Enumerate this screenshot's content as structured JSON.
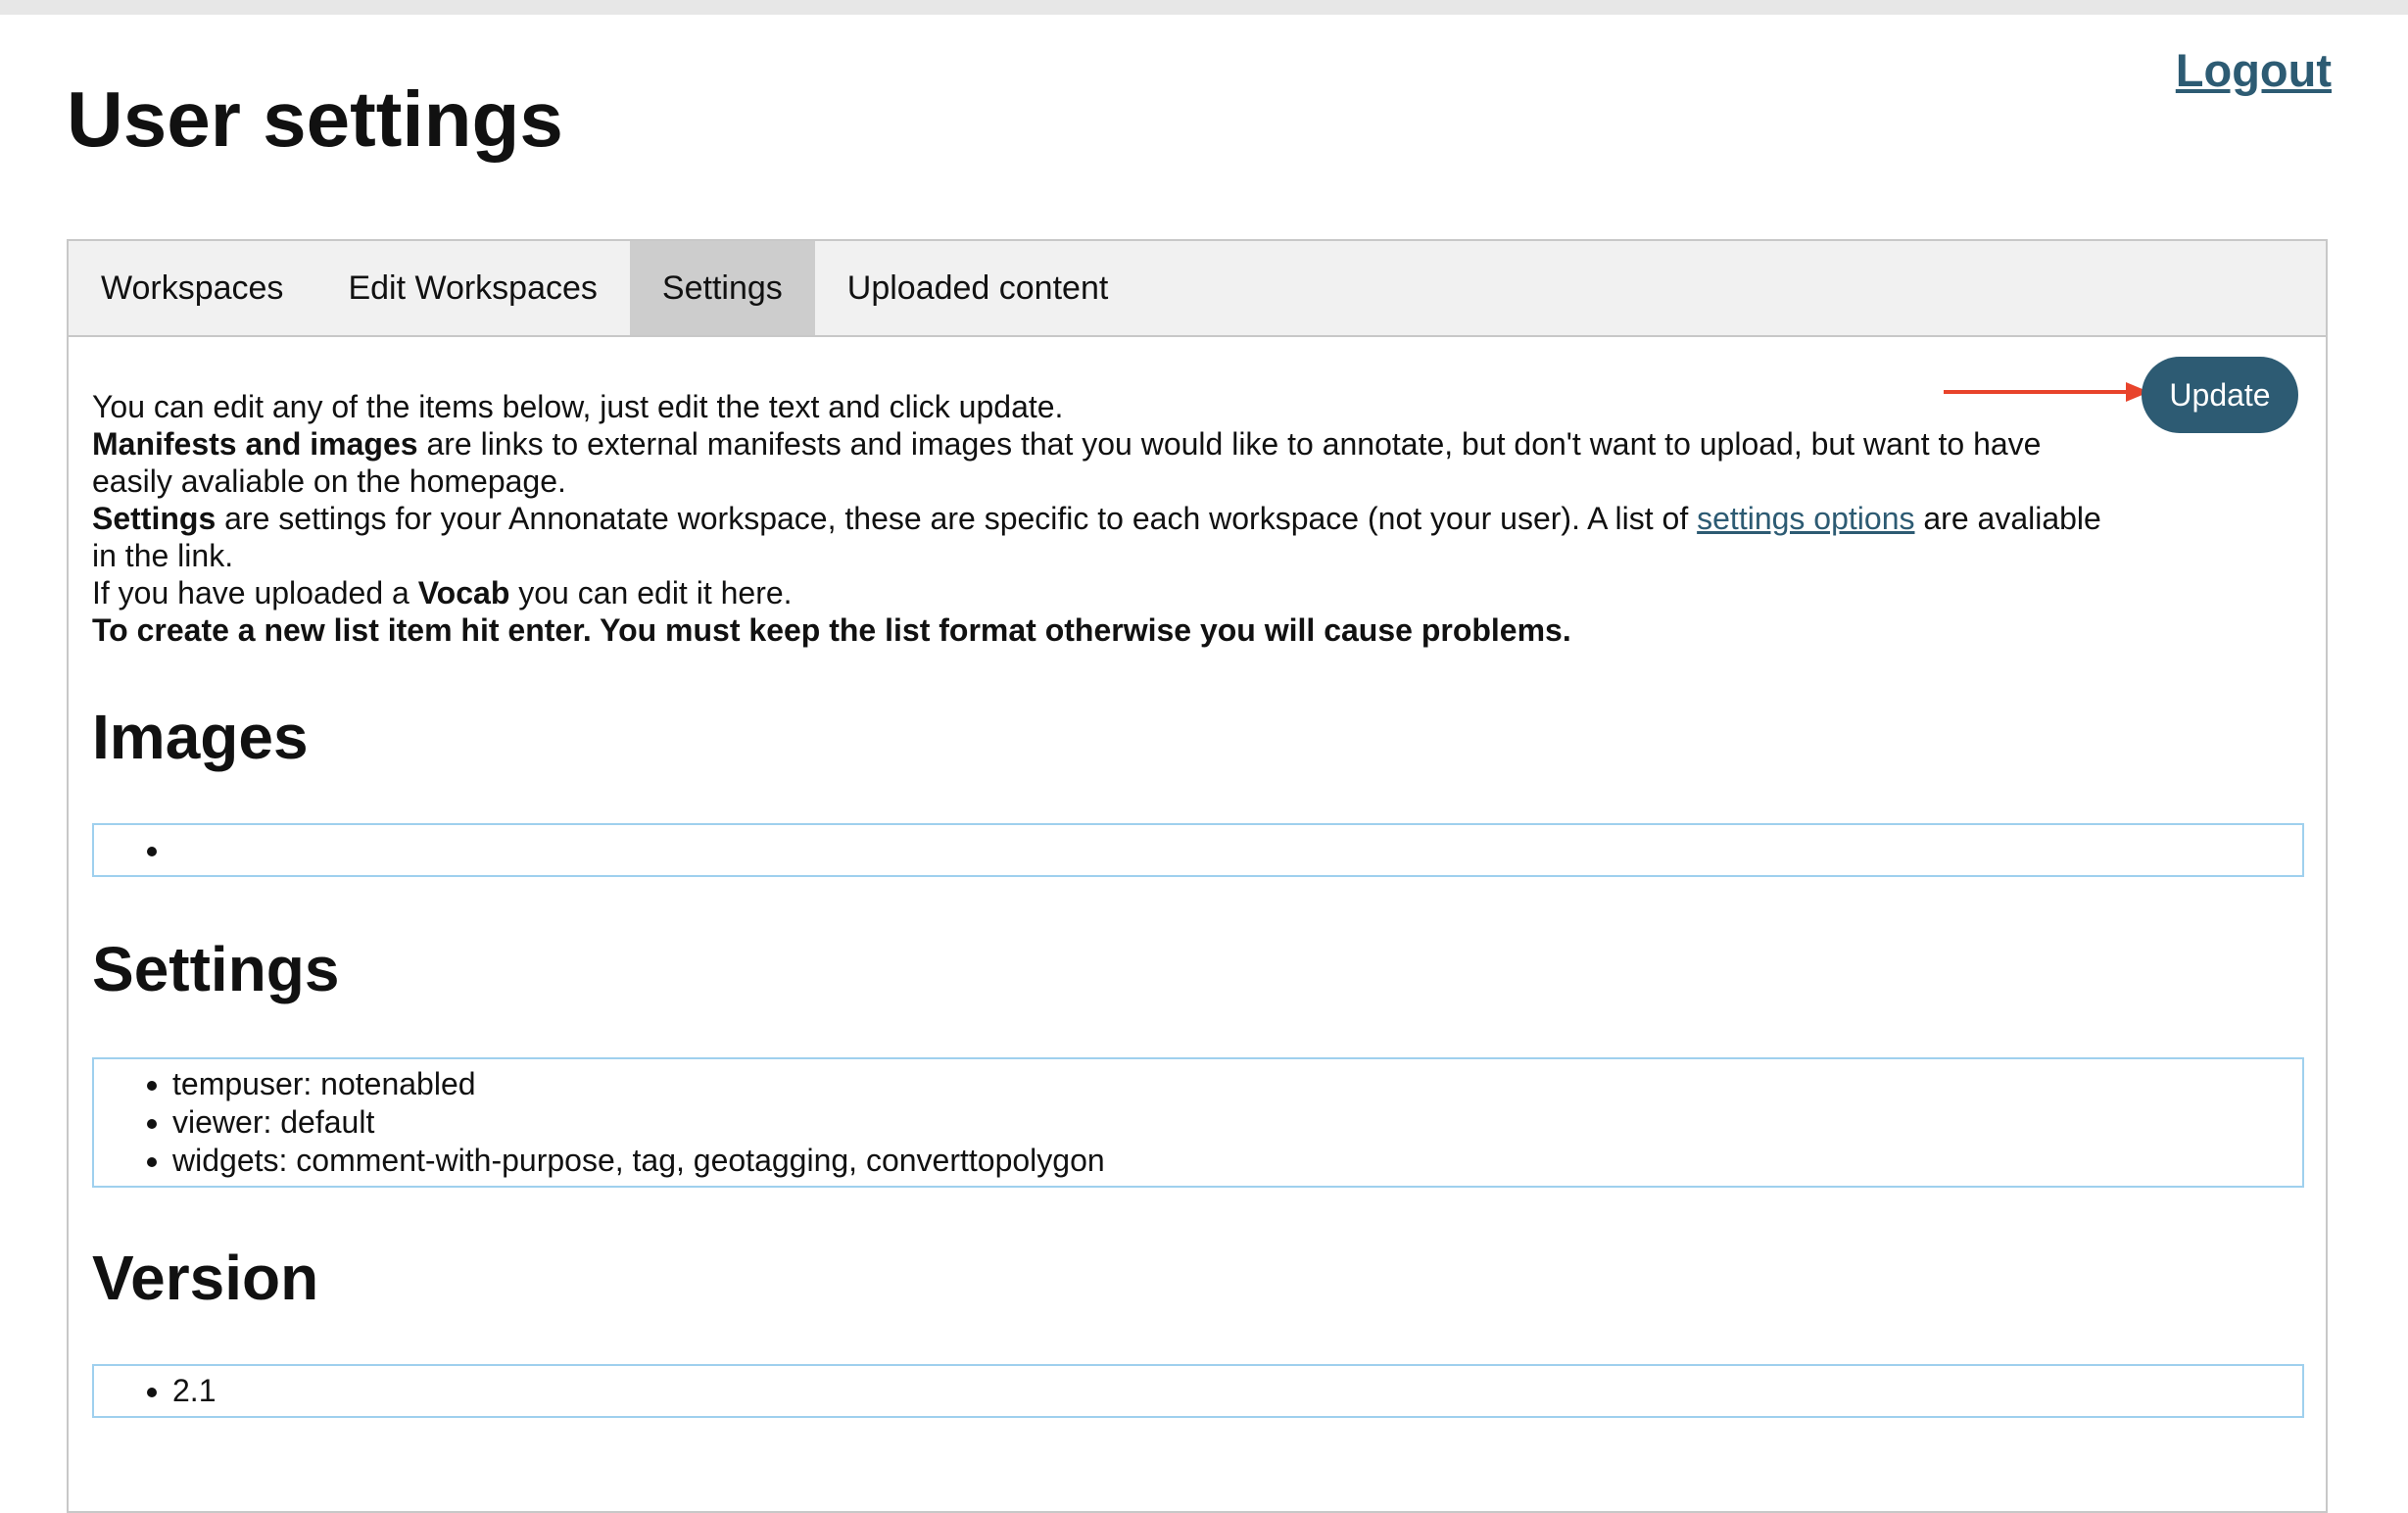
{
  "header": {
    "title": "User settings",
    "logout_label": "Logout"
  },
  "tabs": [
    {
      "label": "Workspaces",
      "active": false
    },
    {
      "label": "Edit Workspaces",
      "active": false
    },
    {
      "label": "Settings",
      "active": true
    },
    {
      "label": "Uploaded content",
      "active": false
    }
  ],
  "update_label": "Update",
  "intro": {
    "line1": "You can edit any of the items below, just edit the text and click update.",
    "manifests_bold": "Manifests and images",
    "manifests_rest": " are links to external manifests and images that you would like to annotate, but don't want to upload, but want to have easily avaliable on the homepage.",
    "settings_bold": "Settings",
    "settings_rest": " are settings for your Annonatate workspace, these are specific to each workspace (not your user). A list of ",
    "settings_link": "settings options",
    "settings_tail": " are avaliable in the link.",
    "vocab_pre": "If you have uploaded a ",
    "vocab_bold": "Vocab",
    "vocab_rest": " you can edit it here.",
    "warning": "To create a new list item hit enter. You must keep the list format otherwise you will cause problems."
  },
  "sections": {
    "images": {
      "heading": "Images",
      "items": [
        ""
      ]
    },
    "settings": {
      "heading": "Settings",
      "items": [
        "tempuser: notenabled",
        "viewer: default",
        "widgets: comment-with-purpose, tag, geotagging, converttopolygon"
      ]
    },
    "version": {
      "heading": "Version",
      "items": [
        "2.1"
      ]
    }
  },
  "colors": {
    "accent": "#2d5b73",
    "arrow": "#e8432b",
    "active_tab": "#cdcdcd",
    "editbox_border": "#9fd0ee"
  }
}
